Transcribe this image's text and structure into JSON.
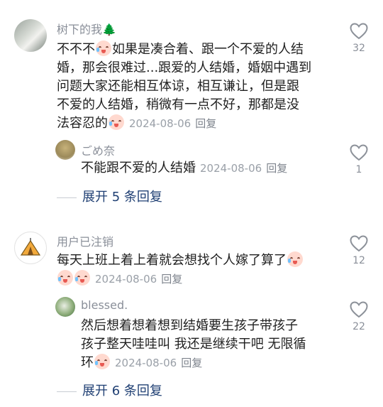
{
  "comments": [
    {
      "user": "树下的我🌲",
      "lines": [
        "不不不[emo]如果是凑合着、跟一个不爱的人结",
        "婚，那会很难过...跟爱的人结婚，婚姻中遇到",
        "问题大家还能相互体谅，相互谦让，但是跟",
        "不爱的人结婚，稍微有一点不好，那都是没",
        "法容忍的"
      ],
      "line1_a": "不不不",
      "line1_b": "如果是凑合着、跟一个不爱的人结",
      "line2": "婚，那会很难过...跟爱的人结婚，婚姻中遇到",
      "line3": "问题大家还能相互体谅，相互谦让，但是跟",
      "line4": "不爱的人结婚，稍微有一点不好，那都是没",
      "line5": "法容忍的",
      "date": "2024-08-06",
      "reply": "回复",
      "likes": "32",
      "sub": {
        "user": "ごめ奈",
        "text": "不能跟不爱的人结婚",
        "date": "2024-08-06",
        "reply": "回复",
        "likes": "1"
      },
      "expand": "展开 5 条回复"
    },
    {
      "user": "用户已注销",
      "line1": "每天上班上着上着就会想找个人嫁了算了",
      "date": "2024-08-06",
      "reply": "回复",
      "likes": "12",
      "sub": {
        "user": "blessed.",
        "line1": "然后想着想着想到结婚要生孩子带孩子",
        "line2": "孩子整天哇哇叫 我还是继续干吧 无限循",
        "line3": "环",
        "date": "2024-08-06",
        "reply": "回复",
        "likes": "22"
      },
      "expand": "展开 6 条回复"
    }
  ],
  "icons": {
    "emoji": "crying-laughing-emoji",
    "like": "heart-outline-icon"
  }
}
